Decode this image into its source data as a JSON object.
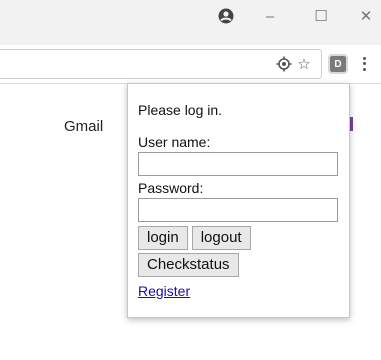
{
  "window": {
    "profile_icon": "account-circle-icon",
    "minimize_glyph": "–",
    "maximize_glyph": "☐",
    "close_glyph": "✕"
  },
  "toolbar": {
    "location_icon": "location-target-icon",
    "star_glyph": "☆",
    "extension_badge": "D",
    "menu_icon": "three-dot-menu-icon"
  },
  "page": {
    "gmail_link": "Gmail"
  },
  "popup": {
    "prompt": "Please log in.",
    "username_label": "User name:",
    "username_value": "",
    "password_label": "Password:",
    "password_value": "",
    "login_button": "login",
    "logout_button": "logout",
    "checkstatus_button": "Checkstatus",
    "register_link": "Register"
  },
  "colors": {
    "link": "#1a0dab",
    "button_bg": "#e8e8e8",
    "titlebar_bg": "#f2f2f2"
  }
}
